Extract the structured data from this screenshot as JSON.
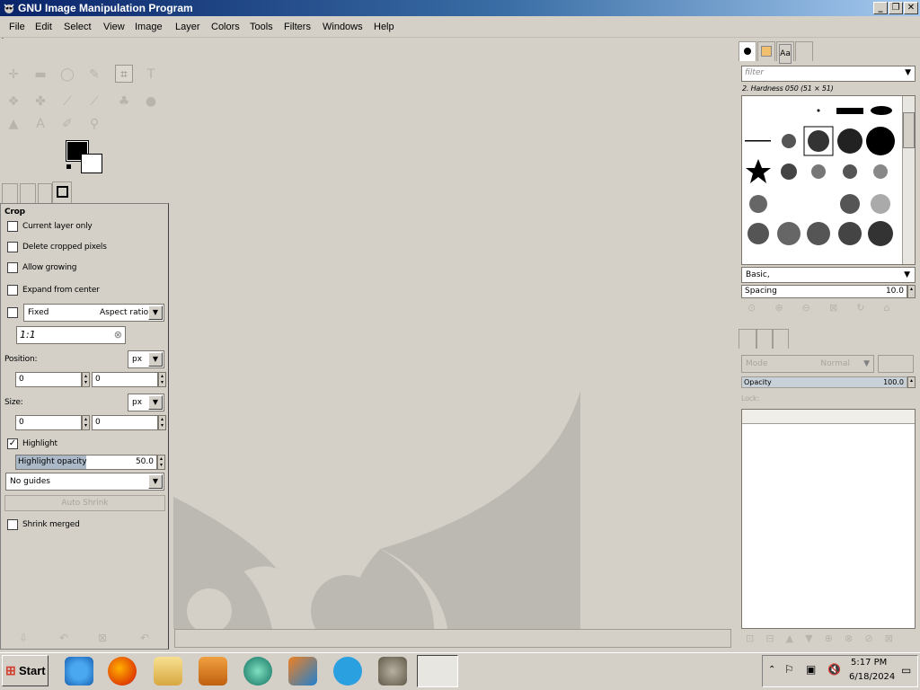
{
  "window": {
    "title": "GNU Image Manipulation Program",
    "controls": [
      "_",
      "❐",
      "✕"
    ]
  },
  "menubar": [
    "File",
    "Edit",
    "Select",
    "View",
    "Image",
    "Layer",
    "Colors",
    "Tools",
    "Filters",
    "Windows",
    "Help"
  ],
  "tool_options": {
    "title": "Crop",
    "current_layer_only": "Current layer only",
    "delete_cropped": "Delete cropped pixels",
    "allow_growing": "Allow growing",
    "expand_from_center": "Expand from center",
    "fixed": "Fixed",
    "aspect_ratio": "Aspect ratio",
    "ratio_value": "1:1",
    "position_label": "Position:",
    "position_unit": "px",
    "position_x": "0",
    "position_y": "0",
    "size_label": "Size:",
    "size_unit": "px",
    "size_w": "0",
    "size_h": "0",
    "highlight": "Highlight",
    "highlight_opacity_label": "Highlight opacity",
    "highlight_opacity": "50.0",
    "guides": "No guides",
    "auto_shrink": "Auto Shrink",
    "shrink_merged": "Shrink merged"
  },
  "brushes": {
    "filter_placeholder": "filter",
    "selected": "2. Hardness 050 (51 × 51)",
    "tag": "Basic,",
    "spacing_label": "Spacing",
    "spacing_value": "10.0"
  },
  "layers": {
    "mode_label": "Mode",
    "mode_value": "Normal",
    "opacity_label": "Opacity",
    "opacity_value": "100.0",
    "lock_label": "Lock:"
  },
  "taskbar": {
    "start": "Start",
    "time": "5:17 PM",
    "date": "6/18/2024"
  }
}
